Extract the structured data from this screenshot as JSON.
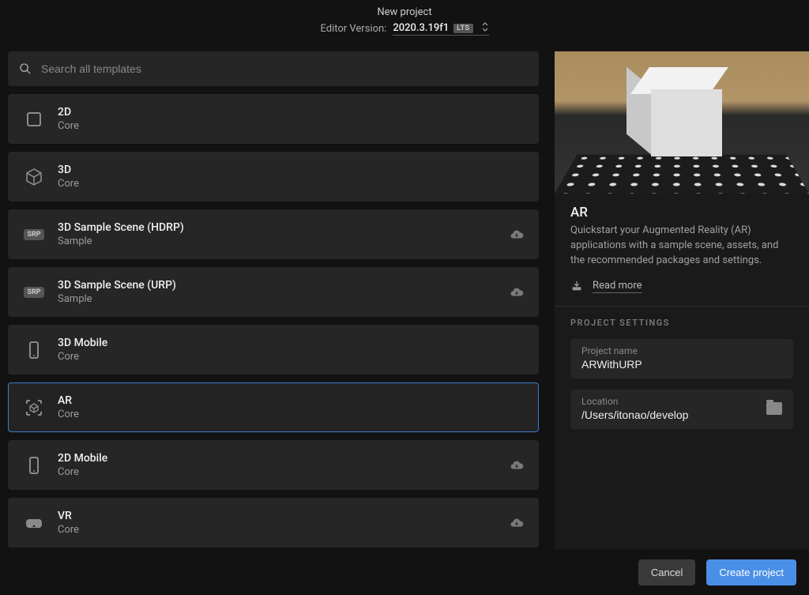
{
  "header": {
    "title": "New project",
    "editor_label": "Editor Version:",
    "version": "2020.3.19f1",
    "lts_badge": "LTS"
  },
  "search": {
    "placeholder": "Search all templates"
  },
  "templates": [
    {
      "name": "2D",
      "category": "Core",
      "icon": "square",
      "download": false,
      "selected": false
    },
    {
      "name": "3D",
      "category": "Core",
      "icon": "cube",
      "download": false,
      "selected": false
    },
    {
      "name": "3D Sample Scene (HDRP)",
      "category": "Sample",
      "icon": "srp",
      "download": true,
      "selected": false
    },
    {
      "name": "3D Sample Scene (URP)",
      "category": "Sample",
      "icon": "srp",
      "download": true,
      "selected": false
    },
    {
      "name": "3D Mobile",
      "category": "Core",
      "icon": "mobile",
      "download": false,
      "selected": false
    },
    {
      "name": "AR",
      "category": "Core",
      "icon": "ar",
      "download": false,
      "selected": true
    },
    {
      "name": "2D Mobile",
      "category": "Core",
      "icon": "mobile",
      "download": true,
      "selected": false
    },
    {
      "name": "VR",
      "category": "Core",
      "icon": "vr",
      "download": true,
      "selected": false
    }
  ],
  "detail": {
    "title": "AR",
    "description": "Quickstart your Augmented Reality (AR) applications with a sample scene, assets, and the recommended packages and settings.",
    "read_more": "Read more"
  },
  "settings": {
    "heading": "PROJECT SETTINGS",
    "project_name_label": "Project name",
    "project_name_value": "ARWithURP",
    "location_label": "Location",
    "location_value": "/Users/itonao/develop"
  },
  "footer": {
    "cancel": "Cancel",
    "create": "Create project"
  }
}
